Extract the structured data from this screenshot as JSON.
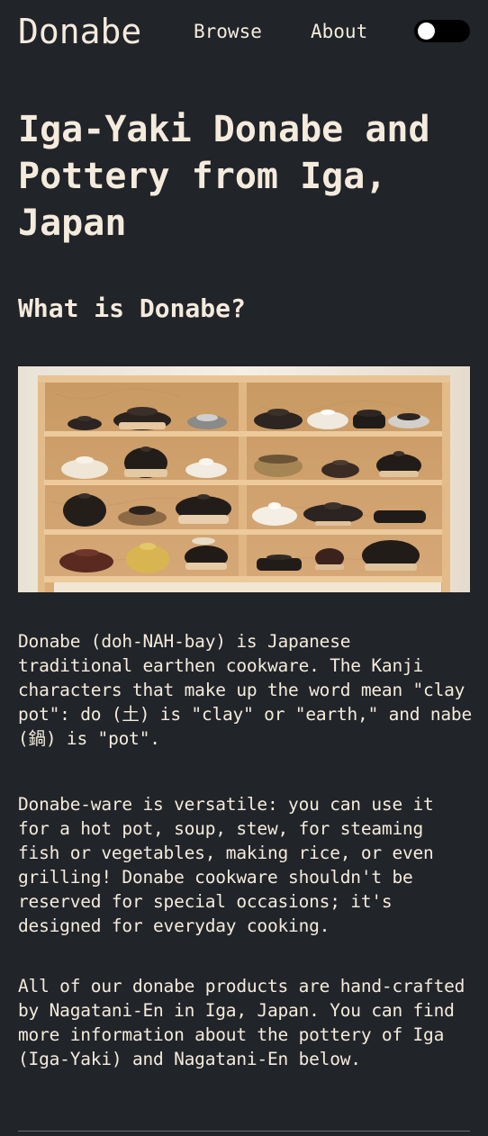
{
  "nav": {
    "brand": "Donabe",
    "links": [
      "Browse",
      "About"
    ],
    "theme_toggle_state": "off"
  },
  "page": {
    "title": "Iga-Yaki Donabe and Pottery from Iga, Japan",
    "heading": "What is Donabe?",
    "paragraphs": [
      "Donabe (doh-NAH-bay) is Japanese traditional earthen cookware. The Kanji characters that make up the word mean \"clay pot\": do (土) is \"clay\" or \"earth,\" and nabe (鍋) is \"pot\".",
      "Donabe-ware is versatile: you can use it for a hot pot, soup, stew, for steaming fish or vegetables, making rice, or even grilling! Donabe cookware shouldn't be reserved for special occasions; it's designed for everyday cooking.",
      "All of our donabe products are hand-crafted by Nagatani-En in Iga, Japan. You can find more information about the pottery of Iga (Iga-Yaki) and Nagatani-En below."
    ]
  },
  "colors": {
    "background": "#212428",
    "text": "#f4ebdd",
    "toggle_track": "#000000",
    "toggle_knob": "#ffffff",
    "divider": "#6b6d70"
  }
}
